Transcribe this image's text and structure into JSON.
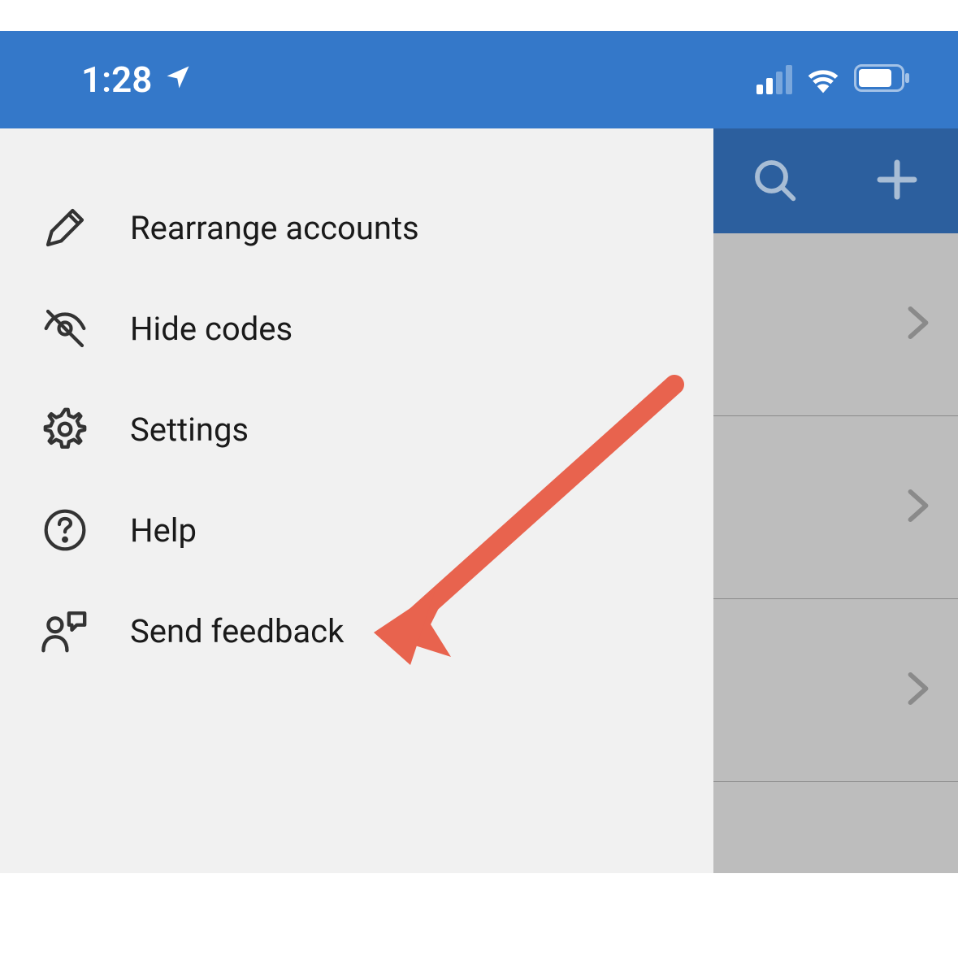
{
  "status_bar": {
    "time": "1:28",
    "colors": {
      "background": "#3478c9",
      "foreground": "#ffffff"
    }
  },
  "menu": {
    "items": [
      {
        "icon": "pencil-icon",
        "label": "Rearrange accounts"
      },
      {
        "icon": "eye-slash-icon",
        "label": "Hide codes"
      },
      {
        "icon": "gear-icon",
        "label": "Settings"
      },
      {
        "icon": "help-icon",
        "label": "Help"
      },
      {
        "icon": "feedback-icon",
        "label": "Send feedback"
      }
    ]
  },
  "back_header": {
    "icons": [
      "search-icon",
      "plus-icon"
    ]
  },
  "annotation": {
    "type": "arrow",
    "color": "#e8634e",
    "target_menu_index": 4
  }
}
